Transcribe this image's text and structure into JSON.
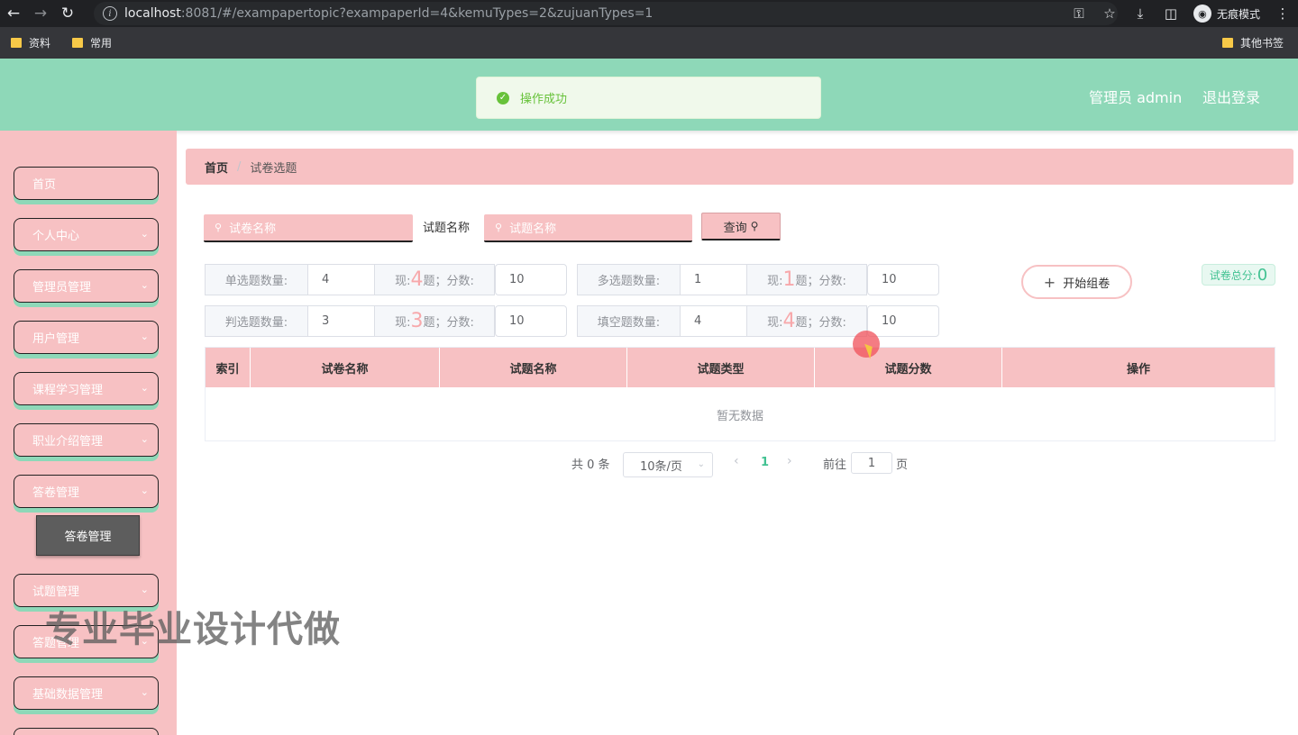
{
  "browser": {
    "url_host": "localhost",
    "url_rest": ":8081/#/exampapertopic?exampaperId=4&kemuTypes=2&zujuanTypes=1",
    "incognito_label": "无痕模式",
    "bookmarks": [
      "资料",
      "常用"
    ],
    "other_bookmarks": "其他书签"
  },
  "header": {
    "user": "管理员 admin",
    "logout": "退出登录",
    "toast": "操作成功"
  },
  "sidebar": {
    "items": [
      "首页",
      "个人中心",
      "管理员管理",
      "用户管理",
      "课程学习管理",
      "职业介绍管理",
      "答卷管理",
      "试题管理",
      "答题管理",
      "基础数据管理"
    ],
    "sub_item": "答卷管理"
  },
  "breadcrumb": {
    "home": "首页",
    "current": "试卷选题"
  },
  "search": {
    "paper_placeholder": "试卷名称",
    "topic_label": "试题名称",
    "topic_placeholder": "试题名称",
    "query_button": "查询"
  },
  "config": {
    "single": {
      "label": "单选题数量:",
      "value": "4",
      "now_prefix": "现:",
      "now": "4",
      "now_suffix": "题；分数:",
      "score": "10"
    },
    "multi": {
      "label": "多选题数量:",
      "value": "1",
      "now_prefix": "现:",
      "now": "1",
      "now_suffix": "题；分数:",
      "score": "10"
    },
    "judge": {
      "label": "判选题数量:",
      "value": "3",
      "now_prefix": "现:",
      "now": "3",
      "now_suffix": "题；分数:",
      "score": "10"
    },
    "fill": {
      "label": "填空题数量:",
      "value": "4",
      "now_prefix": "现:",
      "now": "4",
      "now_suffix": "题；分数:",
      "score": "10"
    },
    "start_button": "开始组卷",
    "total_label": "试卷总分:",
    "total_value": "0"
  },
  "table": {
    "columns": [
      "索引",
      "试卷名称",
      "试题名称",
      "试题类型",
      "试题分数",
      "操作"
    ],
    "empty_text": "暂无数据"
  },
  "pagination": {
    "total": "共 0 条",
    "page_size": "10条/页",
    "current_page": "1",
    "goto_label": "前往",
    "goto_value": "1",
    "page_label": "页"
  },
  "watermark": "专业毕业设计代做"
}
